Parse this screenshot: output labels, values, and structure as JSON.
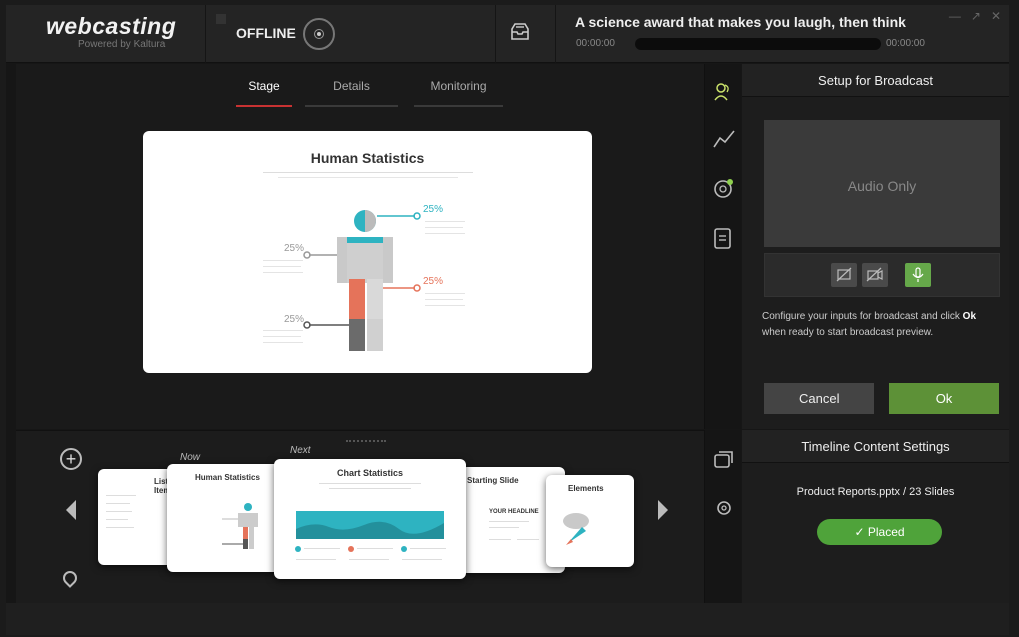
{
  "header": {
    "logo": "webcasting",
    "tagline": "Powered by Kaltura",
    "status": "OFFLINE",
    "event_title": "A science award that makes you laugh, then think",
    "time_start": "00:00:00",
    "time_end": "00:00:00"
  },
  "stage": {
    "tabs": [
      {
        "label": "Stage",
        "active": true
      },
      {
        "label": "Details",
        "active": false
      },
      {
        "label": "Monitoring",
        "active": false
      }
    ],
    "slide_title": "Human Statistics",
    "percents": [
      "25%",
      "25%",
      "25%",
      "25%"
    ]
  },
  "setup": {
    "title": "Setup for Broadcast",
    "preview_label": "Audio Only",
    "info_text": "Configure your inputs for broadcast and click ",
    "info_bold": "Ok",
    "info_tail": " when ready to start broadcast preview.",
    "cancel_label": "Cancel",
    "ok_label": "Ok"
  },
  "filmstrip": {
    "now_label": "Now",
    "next_label": "Next",
    "cards": [
      {
        "title": "List Items"
      },
      {
        "title": "Human Statistics"
      },
      {
        "title": "Chart Statistics"
      },
      {
        "title": "Starting Slide",
        "headline": "YOUR HEADLINE"
      },
      {
        "title": "Elements"
      }
    ]
  },
  "timeline": {
    "title": "Timeline Content Settings",
    "file": "Product Reports.pptx / 23 Slides",
    "placed_label": "Placed"
  },
  "colors": {
    "accent_red": "#c83232",
    "ok_green": "#5d9137",
    "placed_green": "#4fa33a",
    "teal": "#2eb3c1"
  }
}
